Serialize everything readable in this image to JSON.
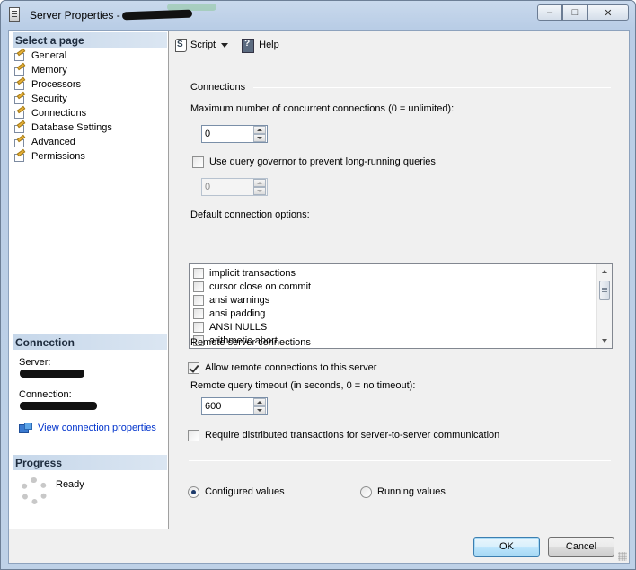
{
  "window": {
    "title": "Server Properties - ",
    "minimize": "–",
    "maximize": "□",
    "close": "✕"
  },
  "left": {
    "select_page_header": "Select a page",
    "pages": [
      {
        "label": "General",
        "icon": "wrench-page-icon"
      },
      {
        "label": "Memory",
        "icon": "wrench-page-icon"
      },
      {
        "label": "Processors",
        "icon": "wrench-page-icon"
      },
      {
        "label": "Security",
        "icon": "wrench-page-icon"
      },
      {
        "label": "Connections",
        "icon": "wrench-page-icon"
      },
      {
        "label": "Database Settings",
        "icon": "wrench-page-icon"
      },
      {
        "label": "Advanced",
        "icon": "wrench-page-icon"
      },
      {
        "label": "Permissions",
        "icon": "wrench-page-icon"
      }
    ],
    "connection_header": "Connection",
    "server_label": "Server:",
    "connection_label": "Connection:",
    "view_link": "View connection properties",
    "progress_header": "Progress",
    "progress_status": "Ready"
  },
  "toolbar": {
    "script_label": "Script",
    "help_label": "Help"
  },
  "connections": {
    "group_title": "Connections",
    "max_conn_label": "Maximum number of concurrent connections (0 = unlimited):",
    "max_conn_value": "0",
    "query_governor_label": "Use query governor to prevent long-running queries",
    "query_governor_checked": false,
    "query_governor_value": "0",
    "default_options_label": "Default connection options:",
    "default_options": [
      {
        "label": "implicit transactions",
        "checked": false
      },
      {
        "label": "cursor close on commit",
        "checked": false
      },
      {
        "label": "ansi warnings",
        "checked": false
      },
      {
        "label": "ansi padding",
        "checked": false
      },
      {
        "label": "ANSI NULLS",
        "checked": false
      },
      {
        "label": "arithmetic abort",
        "checked": false
      }
    ]
  },
  "remote": {
    "group_title": "Remote server connections",
    "allow_remote_label": "Allow remote connections to this server",
    "allow_remote_checked": true,
    "timeout_label": "Remote query timeout (in seconds, 0 = no timeout):",
    "timeout_value": "600",
    "require_distributed_label": "Require distributed transactions for server-to-server communication",
    "require_distributed_checked": false
  },
  "values_mode": {
    "configured_label": "Configured values",
    "running_label": "Running values",
    "selected": "configured"
  },
  "buttons": {
    "ok": "OK",
    "cancel": "Cancel"
  },
  "colors": {
    "title_gradient": "#c9d9ec",
    "section_header": "#c6d7ea",
    "link": "#0033cc",
    "default_button_border": "#3c7fb1"
  }
}
